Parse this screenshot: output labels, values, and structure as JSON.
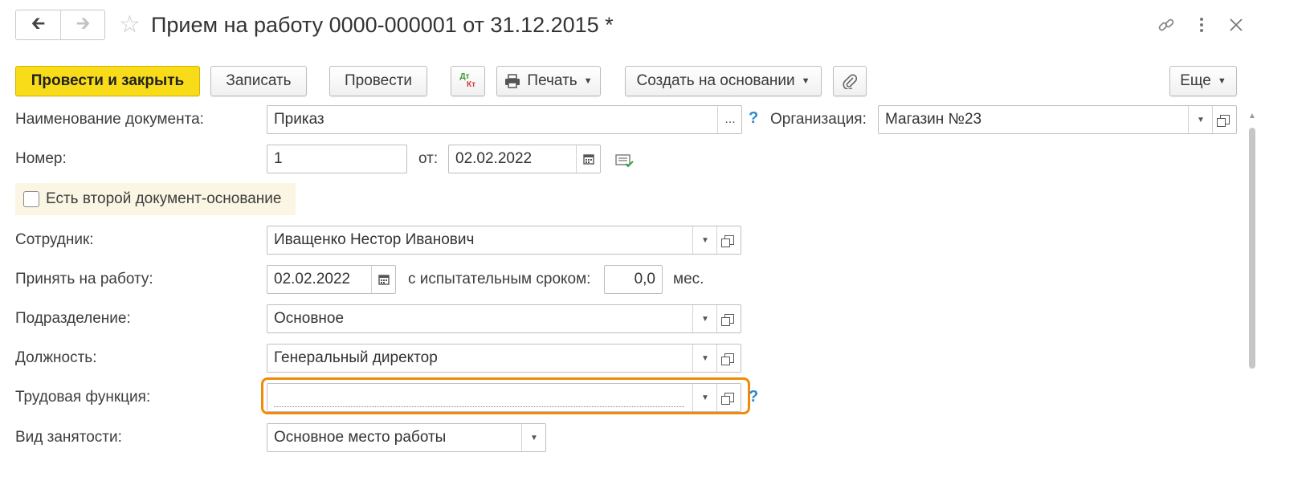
{
  "window": {
    "title": "Прием на работу 0000-000001 от 31.12.2015 *",
    "back_icon": "arrow-left-icon",
    "forward_icon": "arrow-right-icon",
    "favorite_icon": "star-icon",
    "link_icon": "link-icon",
    "menu_icon": "more-vertical-icon",
    "close_icon": "close-icon"
  },
  "toolbar": {
    "post_and_close": "Провести и закрыть",
    "save": "Записать",
    "post": "Провести",
    "dt_kt_top": "Дт",
    "dt_kt_bottom": "Кт",
    "print": "Печать",
    "create_based_on": "Создать на основании",
    "more": "Еще",
    "accent_color": "#f8dc1a"
  },
  "form": {
    "doc_name": {
      "label": "Наименование документа:",
      "value": "Приказ",
      "select_btn": "..."
    },
    "help": "?",
    "organization": {
      "label": "Организация:",
      "value": "Магазин №23"
    },
    "number": {
      "label": "Номер:",
      "value": "1"
    },
    "date": {
      "label": "от:",
      "value": "02.02.2022"
    },
    "second_basis": {
      "label": "Есть второй документ-основание",
      "checked": false
    },
    "employee": {
      "label": "Сотрудник:",
      "value": "Иващенко Нестор Иванович"
    },
    "hire_date": {
      "label": "Принять на работу:",
      "value": "02.02.2022"
    },
    "probation": {
      "label": "с испытательным сроком:",
      "value": "0,0",
      "unit": "мес."
    },
    "department": {
      "label": "Подразделение:",
      "value": "Основное"
    },
    "position": {
      "label": "Должность:",
      "value": "Генеральный директор"
    },
    "labor_function": {
      "label": "Трудовая функция:",
      "value": ""
    },
    "employment_type": {
      "label": "Вид занятости:",
      "value": "Основное место работы"
    },
    "highlight_color": "#f08a0a"
  }
}
